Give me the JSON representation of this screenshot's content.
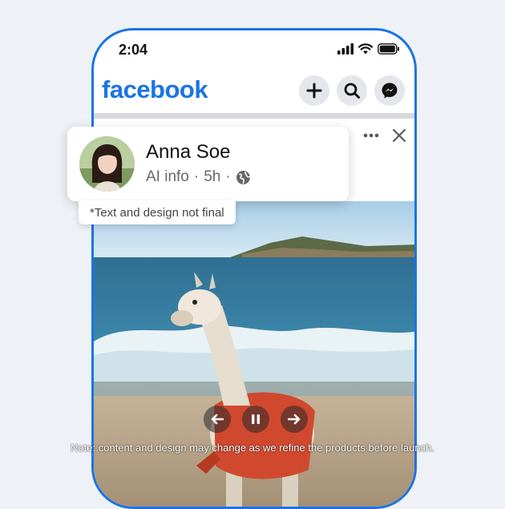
{
  "status_bar": {
    "time": "2:04",
    "icons": [
      "signal-icon",
      "wifi-icon",
      "battery-icon"
    ]
  },
  "header": {
    "logo": "facebook",
    "actions": [
      "plus-icon",
      "search-icon",
      "messenger-icon"
    ]
  },
  "post": {
    "author_name": "Anna Soe",
    "meta_label": "AI info",
    "separator": "·",
    "time_ago": "5h",
    "audience_icon": "globe-icon",
    "actions": [
      "more-icon",
      "close-icon"
    ],
    "disclaimer": "*Text and design not final",
    "media_controls": [
      "back-arrow-icon",
      "pause-icon",
      "forward-arrow-icon"
    ]
  },
  "footnote": "Note: content and design may change as we refine the products before launch.",
  "colors": {
    "brand": "#1b74e4",
    "background": "#eef1f5",
    "button_bg": "#e4e6eb",
    "meta_text": "#65676b"
  }
}
